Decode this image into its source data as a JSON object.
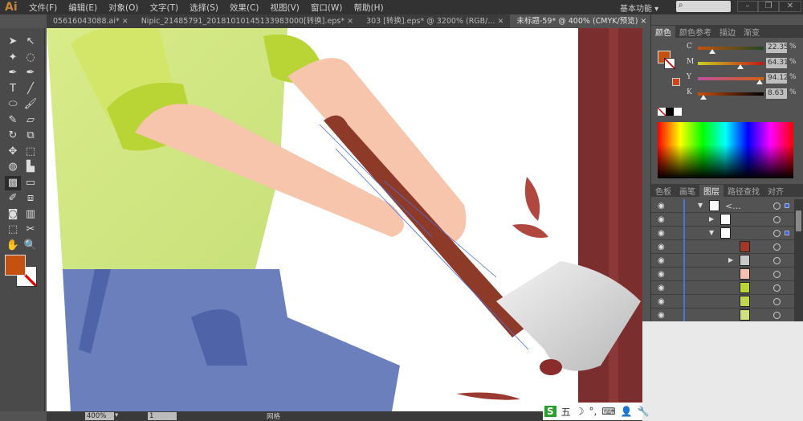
{
  "app": {
    "logo": "Ai",
    "menus": [
      "文件(F)",
      "编辑(E)",
      "对象(O)",
      "文字(T)",
      "选择(S)",
      "效果(C)",
      "视图(V)",
      "窗口(W)",
      "帮助(H)"
    ],
    "workspace": "基本功能",
    "search_placeholder": ""
  },
  "tabs": [
    {
      "label": "05616043088.ai* ×",
      "active": false
    },
    {
      "label": "Nipic_21485791_20181010145133983000[转换].eps*  ×",
      "active": false
    },
    {
      "label": "303 [转换].eps* @ 3200% (RGB/...  ×",
      "active": false
    },
    {
      "label": "未标题-59* @ 400% (CMYK/预览)  ×",
      "active": true
    }
  ],
  "tabs_overflow": ">>",
  "tools": [
    "selection-tool",
    "direct-selection-tool",
    "magic-wand-tool",
    "lasso-tool",
    "pen-tool",
    "curvature-tool",
    "type-tool",
    "line-tool",
    "ellipse-tool",
    "paintbrush-tool",
    "pencil-tool",
    "eraser-tool",
    "rotate-tool",
    "scale-tool",
    "puppet-warp-tool",
    "free-transform-tool",
    "shape-builder-tool",
    "perspective-grid-tool",
    "mesh-tool",
    "gradient-tool",
    "eyedropper-tool",
    "blend-tool",
    "symbol-sprayer-tool",
    "column-graph-tool",
    "artboard-tool",
    "slice-tool",
    "hand-tool",
    "zoom-tool"
  ],
  "tool_glyphs": [
    "➤",
    "↖",
    "✦",
    "◌",
    "✒",
    "✒",
    "T",
    "╱",
    "⬭",
    "🖌",
    "✎",
    "▱",
    "↻",
    "⧉",
    "✥",
    "⬚",
    "◍",
    "▙",
    "▩",
    "▭",
    "✐",
    "⧈",
    "◙",
    "▥",
    "⬚",
    "✂",
    "✋",
    "🔍"
  ],
  "active_tool": "mesh-tool",
  "colors": {
    "fill": "#c4510f",
    "stroke": "none"
  },
  "color_panel": {
    "tabs": [
      "颜色",
      "颜色参考",
      "描边",
      "渐变"
    ],
    "active": "颜色",
    "swatch": "#d2441a",
    "sliders": [
      {
        "label": "C",
        "value": "22.35",
        "percent": 22.35
      },
      {
        "label": "M",
        "value": "64.31",
        "percent": 64.31
      },
      {
        "label": "Y",
        "value": "94.12",
        "percent": 94.12
      },
      {
        "label": "K",
        "value": "8.63",
        "percent": 8.63
      }
    ],
    "unit": "%"
  },
  "layers_panel": {
    "tabs": [
      "色板",
      "画笔",
      "图层",
      "路径查找",
      "对齐"
    ],
    "active": "图层",
    "top_layer_name": "<...",
    "rows": 9
  },
  "status": {
    "zoom": "400%",
    "artboard": "1",
    "tool_name": "网格"
  },
  "ime": {
    "items": [
      "S",
      "五",
      "☽",
      "°,",
      "⌨",
      "👤",
      "🔧"
    ]
  }
}
